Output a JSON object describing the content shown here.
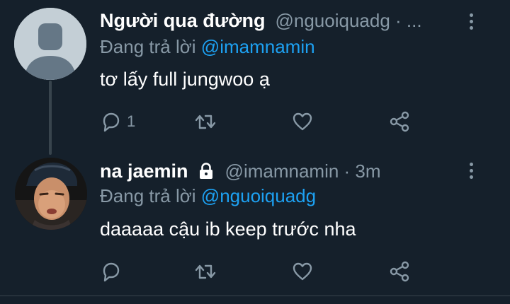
{
  "colors": {
    "background": "#15202b",
    "text_primary": "#ffffff",
    "text_secondary": "#8899a6",
    "accent": "#1da1f2",
    "divider": "#38444d"
  },
  "tweets": [
    {
      "display_name": "Người qua đường",
      "handle_meta": "@nguoiquadg · ...",
      "replying_prefix": "Đang trả lời",
      "replying_to": "@imamnamin",
      "text": "tơ lấy full jungwoo ạ",
      "reply_count": "1",
      "protected": false,
      "avatar": "default-avatar-icon"
    },
    {
      "display_name": "na jaemin",
      "handle_meta": "@imamnamin · 3m",
      "replying_prefix": "Đang trả lời",
      "replying_to": "@nguoiquadg",
      "text": "daaaaa cậu ib keep trước nha",
      "reply_count": "",
      "protected": true,
      "avatar": "user-photo-avatar"
    }
  ]
}
